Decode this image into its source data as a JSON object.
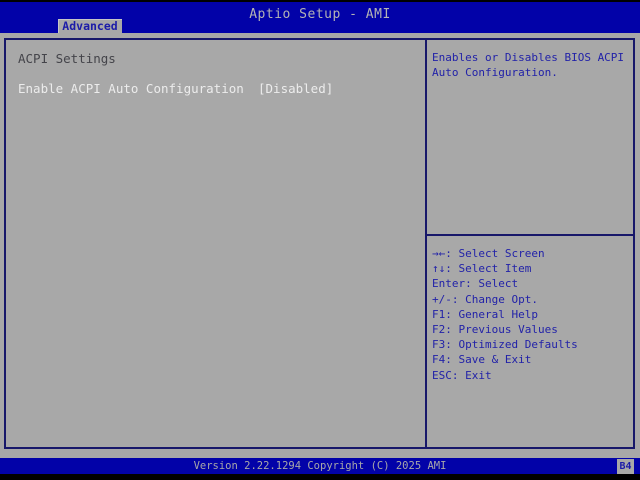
{
  "header": {
    "title": "Aptio Setup - AMI",
    "tab": "Advanced"
  },
  "main_panel": {
    "section_title": "ACPI Settings",
    "items": [
      {
        "label": "Enable ACPI Auto Configuration",
        "value": "[Disabled]",
        "selected": true
      }
    ]
  },
  "help_panel": {
    "description": "Enables or Disables BIOS ACPI Auto Configuration.",
    "key_hints": [
      "→←: Select Screen",
      "↑↓: Select Item",
      "Enter: Select",
      "+/-: Change Opt.",
      "F1: General Help",
      "F2: Previous Values",
      "F3: Optimized Defaults",
      "F4: Save & Exit",
      "ESC: Exit"
    ]
  },
  "footer": {
    "version_text": "Version 2.22.1294 Copyright (C) 2025 AMI",
    "badge": "B4"
  },
  "colors": {
    "header_blue": "#0202a8",
    "background_gray": "#a8a8a8",
    "border_navy": "#18186a",
    "help_text_blue": "#2222a8",
    "selected_item_text": "#ececec",
    "section_title_text": "#44444a"
  }
}
